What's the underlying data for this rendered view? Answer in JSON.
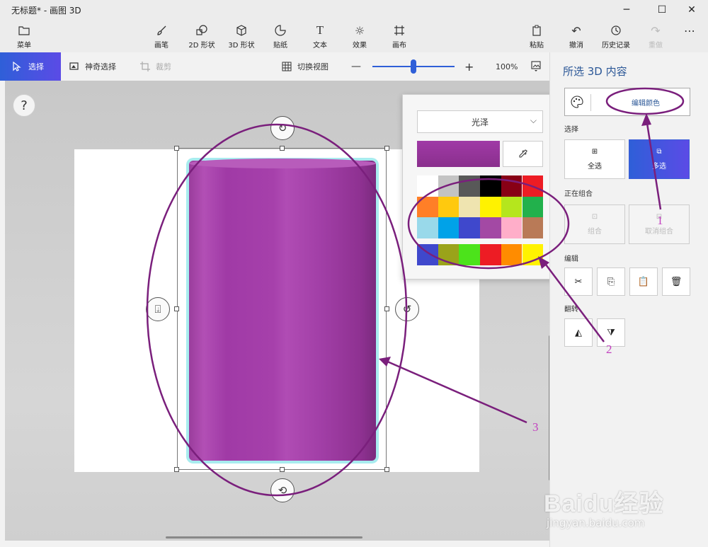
{
  "window": {
    "title": "无标题* - 画图 3D",
    "minimize": "─",
    "maximize": "☐",
    "close": "✕"
  },
  "ribbon": {
    "menu": "菜单",
    "brushes": "画笔",
    "shapes2d": "2D 形状",
    "shapes3d": "3D 形状",
    "stickers": "贴纸",
    "text": "文本",
    "effects": "效果",
    "canvas": "画布",
    "paste": "粘贴",
    "undo": "撤消",
    "history": "历史记录",
    "redo": "重做",
    "more": "⋯"
  },
  "toolbar": {
    "select": "选择",
    "magic_select": "神奇选择",
    "crop": "裁剪",
    "toggle_view": "切换视图",
    "zoom_out": "—",
    "zoom_in": "+",
    "zoom": "100%",
    "zoom_level": 0.5
  },
  "canvas": {
    "help": "?"
  },
  "color_popup": {
    "finish": "光泽",
    "current_color": "#a03aa6",
    "palette": [
      "#ffffff",
      "#c3c3c3",
      "#585858",
      "#000000",
      "#880015",
      "#ed1c24",
      "#ff7f27",
      "#ffc90e",
      "#efe4b0",
      "#fff200",
      "#b5e61d",
      "#22b14c",
      "#99d9ea",
      "#00a2e8",
      "#3f48cc",
      "#a349a4",
      "#ffaec9",
      "#b97a57"
    ],
    "custom": [
      "#3f48cc",
      "#9aa31a",
      "#4ce31b",
      "#ed1c24",
      "#ff8c00",
      "#fff200"
    ]
  },
  "panel": {
    "title": "所选 3D 内容",
    "edit_color": "编辑颜色",
    "section_select": "选择",
    "select_all": "全选",
    "multi_select": "多选",
    "section_group": "正在组合",
    "group": "组合",
    "ungroup": "取消组合",
    "section_edit": "编辑",
    "section_flip": "翻转"
  },
  "annotations": {
    "n1": "1",
    "n2": "2",
    "n3": "3"
  },
  "watermark": {
    "logo": "Baidu经验",
    "url": "jingyan.baidu.com"
  }
}
